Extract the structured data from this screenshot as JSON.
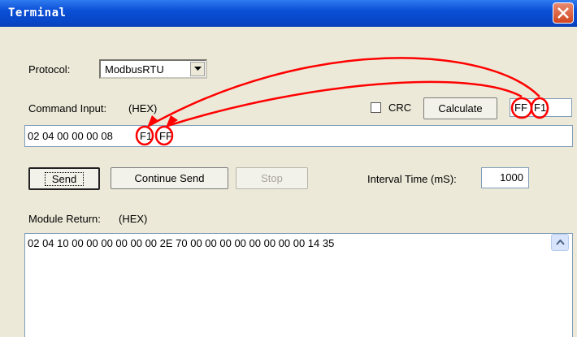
{
  "window": {
    "title": "Terminal"
  },
  "protocol": {
    "label": "Protocol:",
    "value": "ModbusRTU"
  },
  "command": {
    "label": "Command Input:",
    "format": "(HEX)",
    "bytes": "02 04 00 00 00 08",
    "crc_lo": "F1",
    "crc_hi": "FF"
  },
  "crc": {
    "label": "CRC",
    "calculate_label": "Calculate",
    "hi": "FF",
    "lo": "F1"
  },
  "controls": {
    "send_label": "Send",
    "continue_label": "Continue Send",
    "stop_label": "Stop",
    "interval_label": "Interval Time (mS):",
    "interval_value": "1000"
  },
  "module_return": {
    "label": "Module Return:",
    "format": "(HEX)",
    "text": "02 04 10 00 00 00 00 00 00 2E 70 00 00 00 00 00 00 00 00 14 35"
  },
  "colors": {
    "annotation": "#ff0000",
    "title_bar": "#0a4fd6"
  }
}
